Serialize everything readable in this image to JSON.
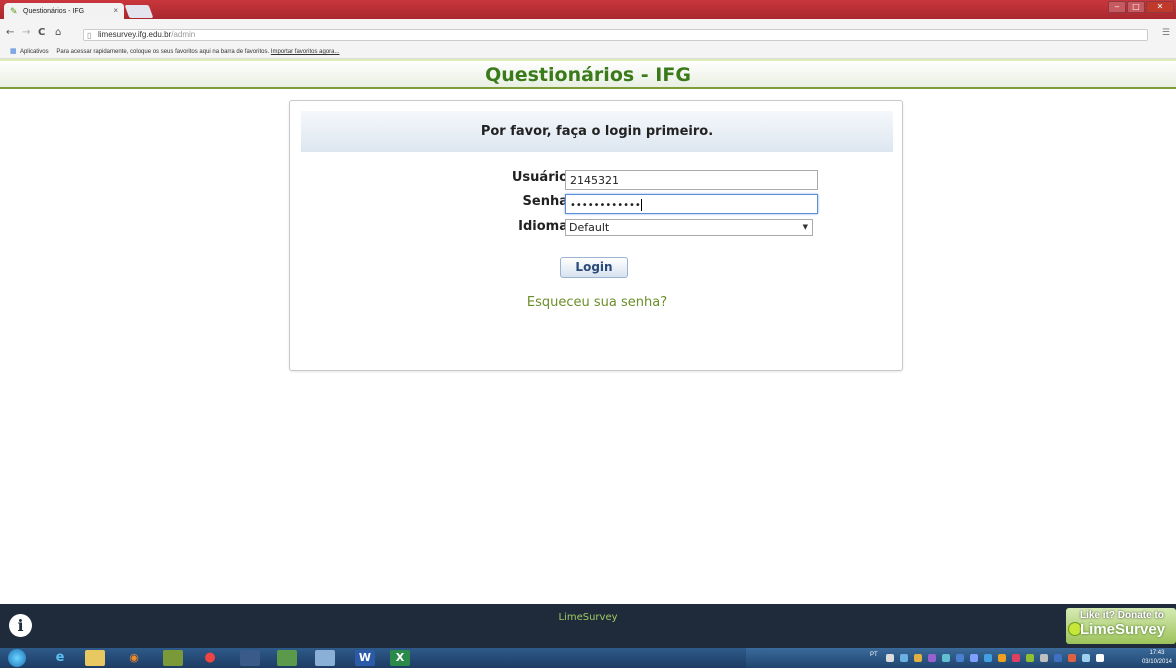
{
  "browser": {
    "tab_title": "Questionários - IFG",
    "tab_close": "×",
    "url_host": "limesurvey.ifg.edu.br",
    "url_path": "/admin",
    "bookmarks_apps": "Aplicativos",
    "bookmarks_hint": "Para acessar rapidamente, coloque os seus favoritos aqui na barra de favoritos.",
    "bookmarks_import": "Importar favoritos agora..."
  },
  "header": {
    "title": "Questionários - IFG"
  },
  "login": {
    "heading": "Por favor, faça o login primeiro.",
    "username_label": "Usuário",
    "username_value": "2145321",
    "password_label": "Senha",
    "password_masked": "••••••••••••",
    "language_label": "Idioma",
    "language_value": "Default",
    "submit_label": "Login",
    "forgot_link": "Esqueceu sua senha?"
  },
  "footer": {
    "link": "LimeSurvey",
    "donate_line1": "Like it? Donate to",
    "donate_line2": "LimeSurvey"
  },
  "taskbar": {
    "lang": "PT",
    "time": "17:43",
    "date": "03/10/2014"
  }
}
